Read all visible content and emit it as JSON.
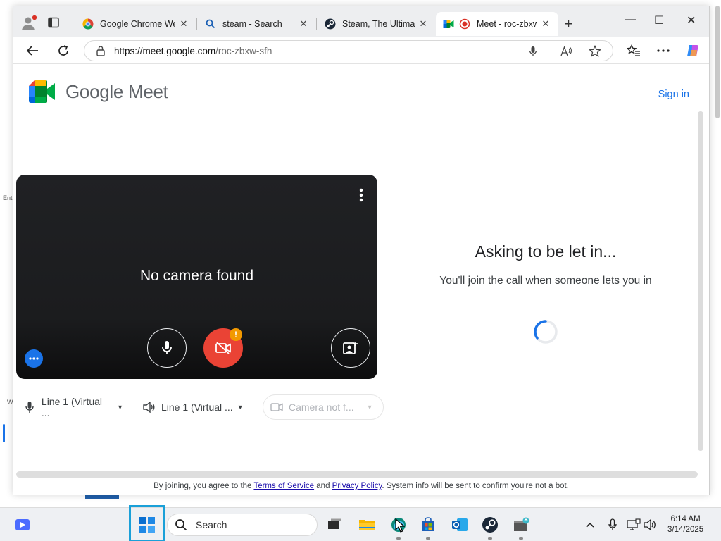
{
  "window": {
    "tabs": [
      {
        "title": "Google Chrome Web",
        "icon": "chrome-icon",
        "active": false
      },
      {
        "title": "steam - Search",
        "icon": "search-icon",
        "active": false
      },
      {
        "title": "Steam, The Ultimate",
        "icon": "steam-icon",
        "active": false
      },
      {
        "title": "Meet - roc-zbxw-",
        "icon": "meet-icon",
        "active": true
      }
    ],
    "new_tab": "+",
    "close_glyph": "✕",
    "controls": {
      "minimize": "—",
      "maximize": "☐",
      "close": "✕"
    }
  },
  "address_bar": {
    "host": "https://meet.google.com",
    "path": "/roc-zbxw-sfh"
  },
  "page": {
    "brand": "Google Meet",
    "sign_in": "Sign in",
    "video": {
      "status": "No camera found",
      "warning_badge": "!"
    },
    "devices": {
      "microphone": "Line 1 (Virtual ...",
      "speaker": "Line 1 (Virtual ...",
      "camera": "Camera not f..."
    },
    "asking": {
      "title": "Asking to be let in...",
      "subtitle": "You'll join the call when someone lets you in"
    },
    "legal": {
      "prefix": "By joining, you agree to the ",
      "terms": "Terms of Service",
      "middle": " and ",
      "privacy": "Privacy Policy",
      "suffix": ". System info will be sent to confirm you're not a bot."
    }
  },
  "desktop": {
    "fragment_1": "Ent",
    "fragment_2": "W"
  },
  "taskbar": {
    "search_placeholder": "Search",
    "time": "6:14 AM",
    "date": "3/14/2025"
  },
  "colors": {
    "accent": "#1a73e8",
    "camera_off": "#ea4335",
    "warning": "#f29900"
  }
}
